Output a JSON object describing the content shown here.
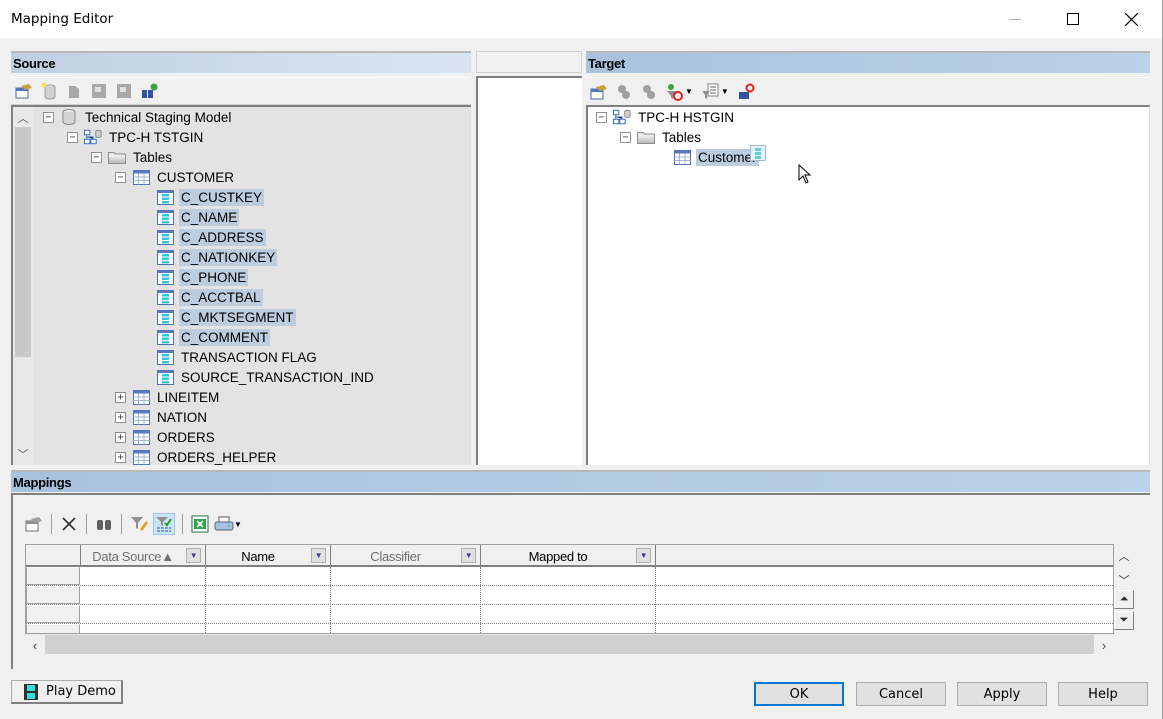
{
  "window": {
    "title": "Mapping Editor",
    "controls": {
      "minimize": "minimize",
      "maximize": "maximize",
      "close": "close"
    }
  },
  "source": {
    "header": "Source",
    "toolbar": [
      "properties-icon",
      "new-model-icon",
      "disabled-icon-1",
      "disabled-icon-2",
      "disabled-icon-3",
      "find-icon"
    ],
    "tree": [
      {
        "label": "Technical Staging Model",
        "level": 0,
        "icon": "model-icon",
        "expander": "minus",
        "selected": false
      },
      {
        "label": "TPC-H TSTGIN",
        "level": 1,
        "icon": "diagram-icon",
        "expander": "minus",
        "selected": false
      },
      {
        "label": "Tables",
        "level": 2,
        "icon": "folder-icon",
        "expander": "minus",
        "selected": false
      },
      {
        "label": "CUSTOMER",
        "level": 3,
        "icon": "table-icon",
        "expander": "minus",
        "selected": false
      },
      {
        "label": "C_CUSTKEY",
        "level": 4,
        "icon": "column-icon",
        "expander": "",
        "selected": true
      },
      {
        "label": "C_NAME",
        "level": 4,
        "icon": "column-icon",
        "expander": "",
        "selected": true
      },
      {
        "label": "C_ADDRESS",
        "level": 4,
        "icon": "column-icon",
        "expander": "",
        "selected": true
      },
      {
        "label": "C_NATIONKEY",
        "level": 4,
        "icon": "column-icon",
        "expander": "",
        "selected": true
      },
      {
        "label": "C_PHONE",
        "level": 4,
        "icon": "column-icon",
        "expander": "",
        "selected": true
      },
      {
        "label": "C_ACCTBAL",
        "level": 4,
        "icon": "column-icon",
        "expander": "",
        "selected": true
      },
      {
        "label": "C_MKTSEGMENT",
        "level": 4,
        "icon": "column-icon",
        "expander": "",
        "selected": true
      },
      {
        "label": "C_COMMENT",
        "level": 4,
        "icon": "column-icon",
        "expander": "",
        "selected": true
      },
      {
        "label": "TRANSACTION FLAG",
        "level": 4,
        "icon": "column-icon",
        "expander": "",
        "selected": false
      },
      {
        "label": "SOURCE_TRANSACTION_IND",
        "level": 4,
        "icon": "column-icon",
        "expander": "",
        "selected": false
      },
      {
        "label": "LINEITEM",
        "level": 3,
        "icon": "table-icon",
        "expander": "plus",
        "selected": false
      },
      {
        "label": "NATION",
        "level": 3,
        "icon": "table-icon",
        "expander": "plus",
        "selected": false
      },
      {
        "label": "ORDERS",
        "level": 3,
        "icon": "table-icon",
        "expander": "plus",
        "selected": false
      },
      {
        "label": "ORDERS_HELPER",
        "level": 3,
        "icon": "table-icon",
        "expander": "plus",
        "selected": false
      }
    ]
  },
  "target": {
    "header": "Target",
    "tree": [
      {
        "label": "TPC-H HSTGIN",
        "level": 0,
        "icon": "diagram-icon",
        "expander": "minus",
        "selected": false
      },
      {
        "label": "Tables",
        "level": 1,
        "icon": "folder-icon",
        "expander": "minus",
        "selected": false
      },
      {
        "label": "Customer",
        "level": 2,
        "icon": "table-icon",
        "expander": "",
        "selected": true
      }
    ]
  },
  "mappings": {
    "header": "Mappings",
    "columns": [
      {
        "label": "Data Source▲",
        "dim": true
      },
      {
        "label": "Name",
        "dim": false
      },
      {
        "label": "Classifier",
        "dim": true
      },
      {
        "label": "Mapped to",
        "dim": false
      }
    ],
    "rows": [
      [],
      [],
      [],
      []
    ]
  },
  "buttons": {
    "play_demo": "Play Demo",
    "ok": "OK",
    "cancel": "Cancel",
    "apply": "Apply",
    "help": "Help"
  }
}
